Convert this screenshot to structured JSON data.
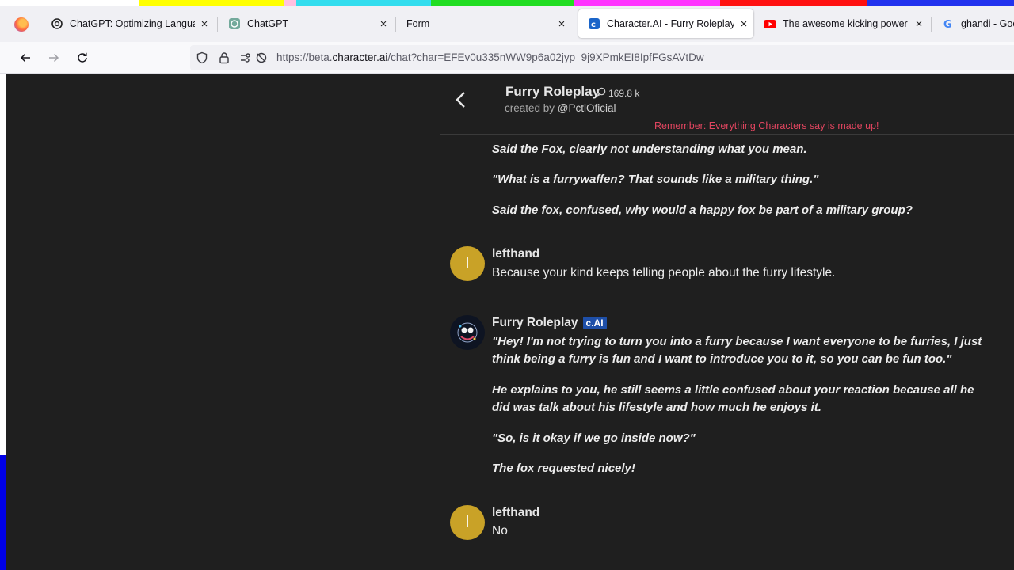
{
  "browser": {
    "tabs": [
      {
        "label": "ChatGPT: Optimizing Language",
        "icon": "openai-icon",
        "active": false
      },
      {
        "label": "ChatGPT",
        "icon": "chatgpt-icon",
        "active": false
      },
      {
        "label": "Form",
        "icon": "",
        "active": false
      },
      {
        "label": "Character.AI - Furry Roleplay",
        "icon": "characterai-icon",
        "active": true
      },
      {
        "label": "The awesome kicking power of",
        "icon": "youtube-icon",
        "active": false
      },
      {
        "label": "ghandi - Goo",
        "icon": "google-icon",
        "active": false
      }
    ],
    "close_glyph": "×",
    "url": {
      "prefix": "https://beta.",
      "domain": "character.ai",
      "path": "/chat?char=EFEv0u335nWW9p6a02jyp_9j9XPmkEI8IpfFGsAVtDw"
    }
  },
  "chat": {
    "character_name": "Furry Roleplay",
    "interaction_count": "169.8 k",
    "created_by_prefix": "created by ",
    "creator_handle": "@PctlOficial",
    "disclaimer": "Remember: Everything Characters say is made up!",
    "fragment": [
      "Said the Fox, clearly not understanding what you mean.",
      "\"What is a furrywaffen? That sounds like a military thing.\"",
      "Said the fox, confused, why would a happy fox be part of a military group?"
    ],
    "messages": [
      {
        "author": "lefthand",
        "avatar_initial": "l",
        "text": "Because your kind keeps telling people about the furry lifestyle."
      },
      {
        "author": "Furry Roleplay",
        "badge": "c.AI",
        "paragraphs": [
          "\"Hey! I'm not trying to turn you into a furry because I want everyone to be furries, I just think being a furry is fun and I want to introduce you to it, so you can be fun too.\"",
          "He explains to you, he still seems a little confused about your reaction because all he did was talk about his lifestyle and how much he enjoys it.",
          "\"So, is it okay if we go inside now?\"",
          "The fox requested nicely!"
        ]
      },
      {
        "author": "lefthand",
        "avatar_initial": "l",
        "text": "No"
      }
    ]
  },
  "colors": {
    "avatar_user": "#c9a227",
    "disclaimer": "#e0455f",
    "badge": "#1e4fa8",
    "page_bg": "#1f1f1f"
  }
}
